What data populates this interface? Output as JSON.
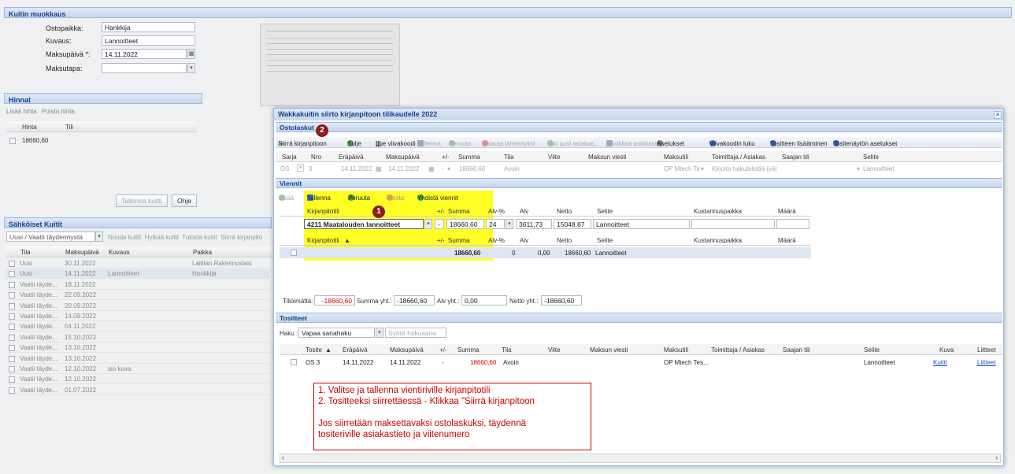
{
  "main": {
    "title": "Kuitin muokkaus",
    "fields": [
      {
        "label": "Ostopaikka:",
        "value": "Hankkija"
      },
      {
        "label": "Kuvaus:",
        "value": "Lannoitteet"
      },
      {
        "label": "Maksupäivä *:",
        "value": "14.11.2022"
      },
      {
        "label": "Maksutapa:",
        "value": ""
      }
    ]
  },
  "hinnat": {
    "title": "Hinnat",
    "add": "Lisää hinta",
    "remove": "Poista hinta",
    "col_hinta": "Hinta",
    "col_tili": "Tili",
    "value": "18660,60"
  },
  "buttons": {
    "save": "Tallenna kuitti",
    "help": "Ohje"
  },
  "receipts": {
    "title": "Sähköiset Kuitit",
    "filter": "Uusi / Vaatii täydennystä",
    "actions": [
      "Nouda kuitit",
      "Hylkää kuitti",
      "Tulosta kuitit",
      "Siirrä kirjanpito"
    ],
    "headers": [
      "Tila",
      "Maksupäivä",
      "Kuvaus",
      "Paikka"
    ],
    "rows": [
      {
        "tila": "Uusi",
        "pvm": "30.11.2022",
        "kuvaus": "",
        "paikka": "Laitilan Rakennuslasi"
      },
      {
        "tila": "Uusi",
        "pvm": "14.11.2022",
        "kuvaus": "Lannoitteet",
        "paikka": "Hankkija"
      },
      {
        "tila": "Vaatii täyde...",
        "pvm": "18.11.2022",
        "kuvaus": "",
        "paikka": ""
      },
      {
        "tila": "Vaatii täyde...",
        "pvm": "22.09.2022",
        "kuvaus": "",
        "paikka": ""
      },
      {
        "tila": "Vaatii täyde...",
        "pvm": "20.09.2022",
        "kuvaus": "",
        "paikka": ""
      },
      {
        "tila": "Vaatii täyde...",
        "pvm": "14.09.2022",
        "kuvaus": "",
        "paikka": ""
      },
      {
        "tila": "Vaatii täyde...",
        "pvm": "04.11.2022",
        "kuvaus": "",
        "paikka": ""
      },
      {
        "tila": "Vaatii täyde...",
        "pvm": "15.10.2022",
        "kuvaus": "",
        "paikka": ""
      },
      {
        "tila": "Vaatii täyde...",
        "pvm": "13.10.2022",
        "kuvaus": "",
        "paikka": ""
      },
      {
        "tila": "Vaatii täyde...",
        "pvm": "13.10.2022",
        "kuvaus": "",
        "paikka": ""
      },
      {
        "tila": "Vaatii täyde...",
        "pvm": "12.10.2022",
        "kuvaus": "iso kuva",
        "paikka": ""
      },
      {
        "tila": "Vaatii täyde...",
        "pvm": "12.10.2022",
        "kuvaus": "",
        "paikka": ""
      },
      {
        "tila": "Vaatii täyde...",
        "pvm": "01.07.2022",
        "kuvaus": "",
        "paikka": ""
      }
    ]
  },
  "dialog": {
    "title": "Wakkakuitin siirto kirjanpitoon tilikaudelle 2022",
    "close": "×",
    "ostolaskut": {
      "title": "Ostolaskut",
      "toolbar": [
        "Siirrä kirjanpitoon",
        "Sulje",
        "Lue viivakoodi",
        "Tallenna",
        "Peruuta",
        "Palauta lähetetyksi",
        "Luo uusi asiakas...",
        "Muokkaa asiakasta",
        "Asetukset",
        "Viivakoodin luku",
        "Tositteen lisääminen",
        "Tositenäytön asetukset"
      ],
      "headers": [
        "Sarja",
        "Nro",
        "Eräpäivä",
        "Maksupäivä",
        "+/-",
        "Summa",
        "Tila",
        "Viite",
        "Maksun viesti",
        "Maksutili",
        "Toimittaja / Asiakas",
        "Saajan tili",
        "Selite"
      ],
      "row": {
        "sarja": "OS",
        "nro": "3",
        "erapaiva": "14.11.2022",
        "maksupaiva": "14.11.2022",
        "pm": "-",
        "summa": "18660,60",
        "tila": "Avoin",
        "viite": "",
        "viesti": "",
        "maksutili": "OP Mtech Te",
        "toimittaja": "Kirjoita hakutekstiä (väl",
        "saaja": "",
        "selite": "Lannoitteet"
      }
    },
    "viennit": {
      "title": "Viennit",
      "toolbar": [
        "Lisää",
        "Tallenna",
        "Peruuta",
        "Poista",
        "Yhdistä viennit"
      ],
      "headers": [
        "Kirjanpitotili",
        "+/-",
        "Summa",
        "Alv-%",
        "Alv",
        "Netto",
        "Selite",
        "Kustannuspaikka",
        "Määrä"
      ],
      "edit": {
        "tili": "4211 Maatalouden lannoitteet",
        "pm": "-",
        "summa": "18660,60",
        "alvp": "24",
        "alv": "3611,73",
        "netto": "15048,87",
        "selite": "Lannoitteet"
      },
      "headers2": [
        "Kirjanpitotili",
        "+/-",
        "Summa",
        "Alv-%",
        "Alv",
        "Netto",
        "Selite",
        "Kustannuspaikka",
        "Määrä"
      ],
      "row": {
        "summa": "18660,60",
        "alvp": "0",
        "alv": "0,00",
        "netto": "18660,60",
        "selite": "Lannoitteet"
      },
      "footer": {
        "t_lbl": "Tiliöimättä:",
        "t_val": "-18660,60",
        "s_lbl": "Summa yht.:",
        "s_val": "-18660,60",
        "a_lbl": "Alv yht.:",
        "a_val": "0,00",
        "n_lbl": "Netto yht.:",
        "n_val": "-18660,60"
      }
    },
    "tositteet": {
      "title": "Tositteet",
      "haku_lbl": "Haku :",
      "haku_val": "Vapaa sanahaku",
      "search_ph": "Syötä hakusana",
      "headers": [
        "Tosite",
        "Eräpäivä",
        "Maksupäivä",
        "+/-",
        "Summa",
        "Tila",
        "Viite",
        "Maksun viesti",
        "Maksutili",
        "Toimittaja / Asiakas",
        "Saajan tili",
        "Selite",
        "Kuva",
        "Liitteet"
      ],
      "row": {
        "tosite": "OS 3",
        "era": "14.11.2022",
        "maksu": "14.11.2022",
        "pm": "-",
        "summa": "18660,60",
        "tila": "Avoin",
        "maksutili": "OP Mtech Tes...",
        "selite": "Lannoitteet",
        "kuva": "Kuitti",
        "liite": "Liitteet"
      }
    }
  },
  "callouts": {
    "m1": "1",
    "m2": "2",
    "lines": [
      "1. Valitse ja tallenna vientiriville kirjanpitotili",
      "2. Tositteeksi siirrettäessä - Klikkaa \"Siirrä kirjanpitoon",
      "Jos siirretään maksettavaksi ostolaskuksi, täydennä",
      "tositeriville asiakastieto ja viitenumero"
    ]
  },
  "colors": {
    "accent": "#15428b",
    "highlight": "#ffff00",
    "callout_border": "#cc0000",
    "marker": "#8b1e1e"
  }
}
